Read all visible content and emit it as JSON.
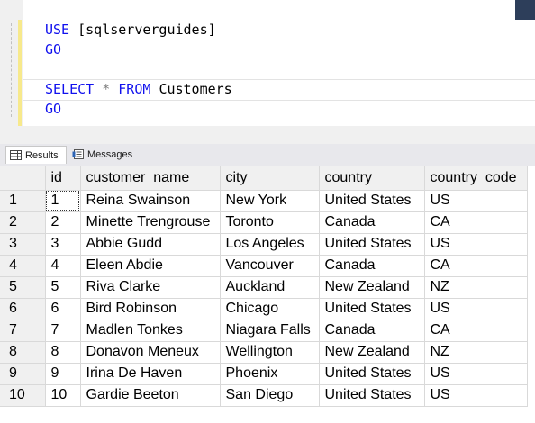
{
  "editor": {
    "lines": [
      {
        "parts": [
          {
            "t": "USE ",
            "c": "kw"
          },
          {
            "t": "[sqlserverguides]",
            "c": "txt"
          }
        ]
      },
      {
        "parts": [
          {
            "t": "GO",
            "c": "kw"
          }
        ]
      },
      {
        "parts": []
      },
      {
        "parts": [
          {
            "t": "SELECT ",
            "c": "kw"
          },
          {
            "t": "* ",
            "c": "op"
          },
          {
            "t": "FROM ",
            "c": "kw"
          },
          {
            "t": "Customers",
            "c": "txt"
          }
        ]
      },
      {
        "parts": [
          {
            "t": "GO",
            "c": "kw"
          }
        ]
      }
    ]
  },
  "tabs": {
    "results_label": "Results",
    "messages_label": "Messages"
  },
  "grid": {
    "columns": [
      "id",
      "customer_name",
      "city",
      "country",
      "country_code"
    ],
    "rows": [
      {
        "n": "1",
        "cells": [
          "1",
          "Reina Swainson",
          "New York",
          "United States",
          "US"
        ]
      },
      {
        "n": "2",
        "cells": [
          "2",
          "Minette Trengrouse",
          "Toronto",
          "Canada",
          "CA"
        ]
      },
      {
        "n": "3",
        "cells": [
          "3",
          "Abbie Gudd",
          "Los Angeles",
          "United States",
          "US"
        ]
      },
      {
        "n": "4",
        "cells": [
          "4",
          "Eleen Abdie",
          "Vancouver",
          "Canada",
          "CA"
        ]
      },
      {
        "n": "5",
        "cells": [
          "5",
          "Riva Clarke",
          "Auckland",
          "New Zealand",
          "NZ"
        ]
      },
      {
        "n": "6",
        "cells": [
          "6",
          "Bird Robinson",
          "Chicago",
          "United States",
          "US"
        ]
      },
      {
        "n": "7",
        "cells": [
          "7",
          "Madlen Tonkes",
          "Niagara Falls",
          "Canada",
          "CA"
        ]
      },
      {
        "n": "8",
        "cells": [
          "8",
          "Donavon Meneux",
          "Wellington",
          "New Zealand",
          "NZ"
        ]
      },
      {
        "n": "9",
        "cells": [
          "9",
          "Irina De Haven",
          "Phoenix",
          "United States",
          "US"
        ]
      },
      {
        "n": "10",
        "cells": [
          "10",
          "Gardie Beeton",
          "San Diego",
          "United States",
          "US"
        ]
      }
    ]
  },
  "colors": {
    "keyword": "#1111ee",
    "operator": "#808080",
    "header_bg": "#f0f0f0",
    "gridline": "#d9d9d9"
  }
}
